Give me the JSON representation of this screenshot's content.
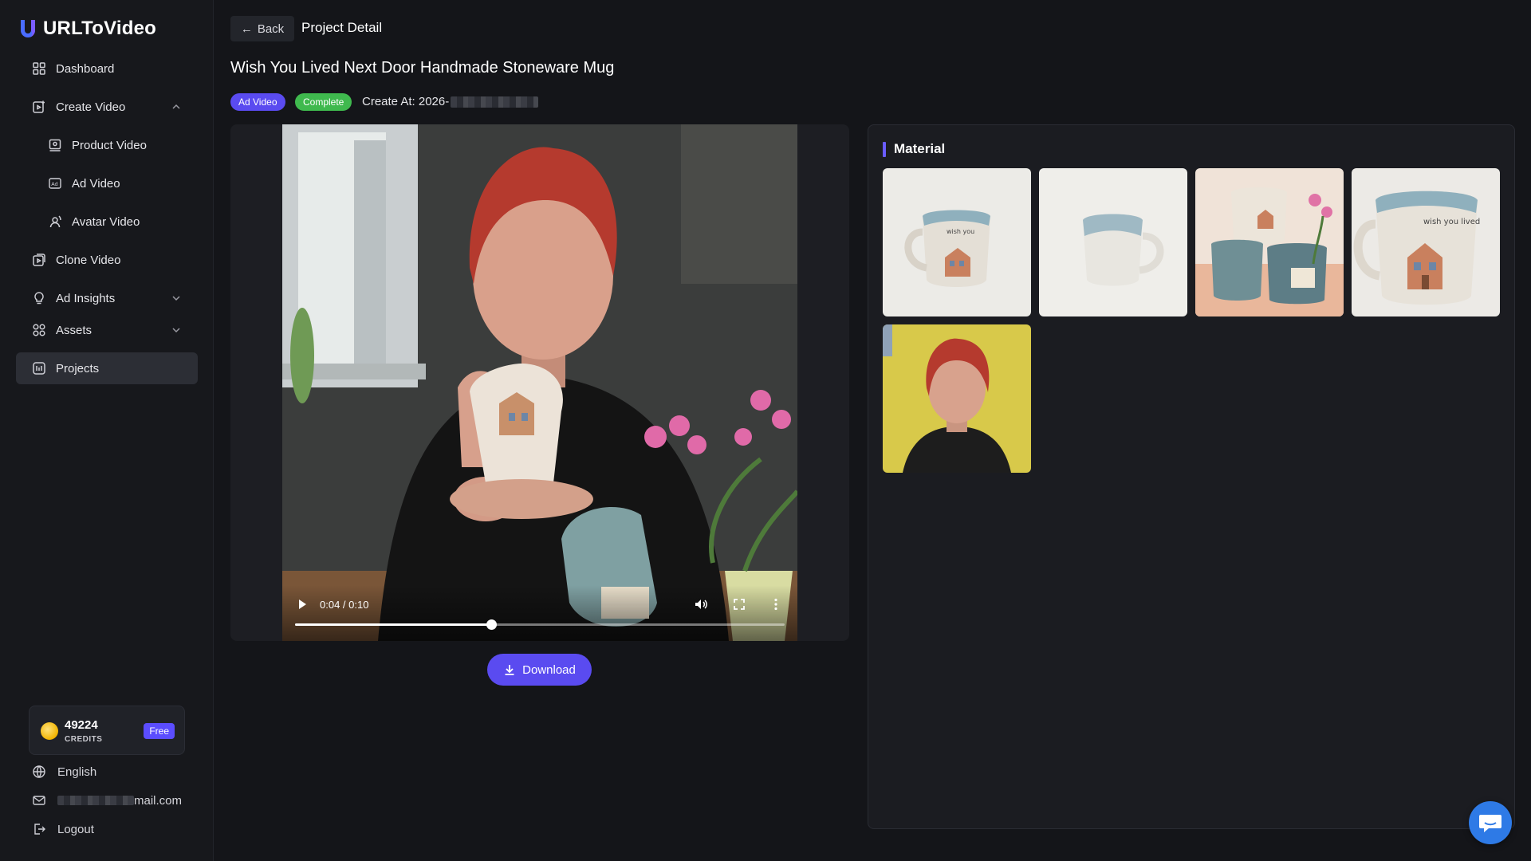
{
  "app": {
    "name": "URLToVideo"
  },
  "sidebar": {
    "items": [
      {
        "label": "Dashboard",
        "icon": "dashboard-icon"
      },
      {
        "label": "Create Video",
        "icon": "create-video-icon",
        "expanded": true
      },
      {
        "label": "Product Video",
        "icon": "product-video-icon"
      },
      {
        "label": "Ad Video",
        "icon": "ad-video-icon"
      },
      {
        "label": "Avatar Video",
        "icon": "avatar-video-icon"
      },
      {
        "label": "Clone Video",
        "icon": "clone-video-icon"
      },
      {
        "label": "Ad Insights",
        "icon": "ad-insights-icon",
        "expanded": false
      },
      {
        "label": "Assets",
        "icon": "assets-icon",
        "expanded": false
      },
      {
        "label": "Projects",
        "icon": "projects-icon",
        "active": true
      }
    ],
    "credits": {
      "amount": "49224",
      "label": "CREDITS",
      "plan": "Free"
    },
    "language": "English",
    "email_suffix": "mail.com",
    "logout": "Logout"
  },
  "header": {
    "back_label": "Back",
    "page_title": "Project Detail"
  },
  "project": {
    "title": "Wish You Lived Next Door Handmade Stoneware Mug",
    "type_tag": "Ad Video",
    "status_tag": "Complete",
    "create_at_prefix": "Create At: 2026-"
  },
  "player": {
    "time_display": "0:04 / 0:10",
    "progress": 0.4
  },
  "download_label": "Download",
  "material": {
    "title": "Material",
    "items": [
      {
        "name": "mug-house-front"
      },
      {
        "name": "mug-plain-blue-rim"
      },
      {
        "name": "mugs-stacked-group"
      },
      {
        "name": "mug-house-closeup"
      },
      {
        "name": "avatar-portrait"
      }
    ]
  },
  "colors": {
    "accent": "#5a4bf0",
    "success": "#3fb94e",
    "background": "#141519",
    "chat": "#2e7ae6"
  }
}
